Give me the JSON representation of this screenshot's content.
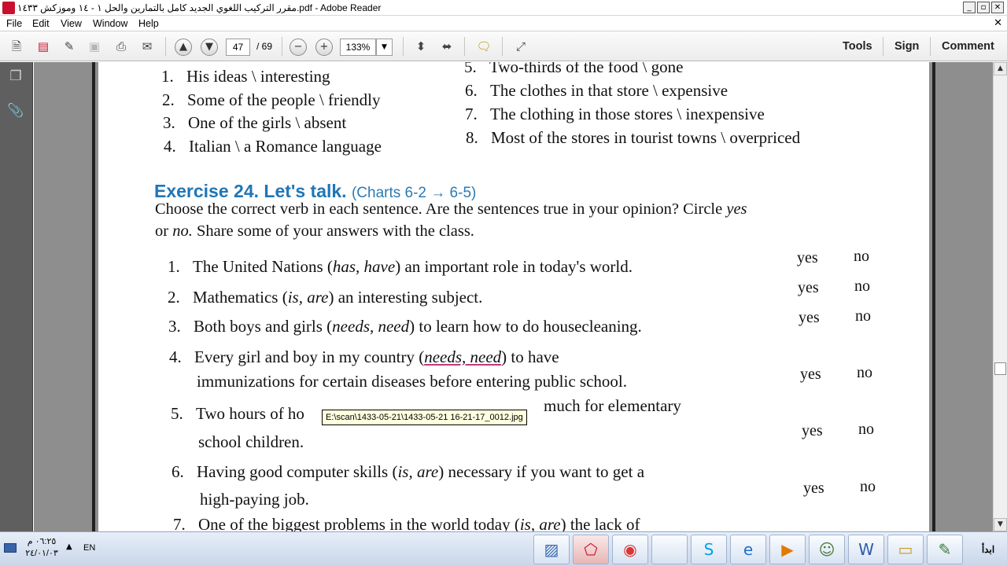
{
  "window": {
    "title": "مقرر التركيب اللغوي  الجديد كامل  بالتمارين والحل ١ - ١٤  وموزكش ١٤٣٣.pdf - Adobe Reader",
    "min_label": "_",
    "max_label": "▫",
    "close_label": "✕"
  },
  "menu": {
    "items": [
      "File",
      "Edit",
      "View",
      "Window",
      "Help"
    ],
    "close_label": "✕"
  },
  "toolbar": {
    "current_page": "47",
    "total_pages": "/ 69",
    "zoom": "133%",
    "tools_label": "Tools",
    "sign_label": "Sign",
    "comment_label": "Comment",
    "icons": [
      "create-icon",
      "share-icon",
      "edit-icon",
      "save-icon",
      "print-icon",
      "email-icon",
      "page-up-icon",
      "page-down-icon",
      "zoom-out-icon",
      "zoom-in-icon",
      "fit-page-icon",
      "fit-width-icon",
      "comment-bubble-icon",
      "full-screen-icon"
    ]
  },
  "document": {
    "top_list_left": [
      {
        "n": "1.",
        "text": "His ideas \\ interesting"
      },
      {
        "n": "2.",
        "text": "Some of the people \\ friendly"
      },
      {
        "n": "3.",
        "text": "One of the girls \\ absent"
      },
      {
        "n": "4.",
        "text": "Italian \\ a Romance language"
      }
    ],
    "top_list_right": [
      {
        "n": "5.",
        "text": "Two-thirds of the food \\ gone"
      },
      {
        "n": "6.",
        "text": "The clothes in that store \\ expensive"
      },
      {
        "n": "7.",
        "text": "The clothing in those stores \\ inexpensive"
      },
      {
        "n": "8.",
        "text": "Most of the stores in tourist towns \\ overpriced"
      }
    ],
    "exercise_title": "Exercise 24. Let's talk.",
    "exercise_ref": "(Charts 6-2 → 6-5)",
    "instruction_1": "Choose the correct verb in each sentence.  Are the sentences true in your opinion?  Circle ",
    "instruction_yes": "yes",
    "instruction_2": "or ",
    "instruction_no": "no.",
    "instruction_3": "  Share some of your answers with the class.",
    "items": [
      {
        "n": "1.",
        "pre": "The United Nations (",
        "choice": "has, have",
        "post": ") an important role in today's world.",
        "line2": ""
      },
      {
        "n": "2.",
        "pre": "Mathematics (",
        "choice": "is, are",
        "post": ") an interesting subject.",
        "line2": ""
      },
      {
        "n": "3.",
        "pre": "Both boys and girls (",
        "choice": "needs, need",
        "post": ") to learn how to do housecleaning.",
        "line2": ""
      },
      {
        "n": "4.",
        "pre": "Every girl and boy in my country (",
        "choice": "needs, need",
        "post": ") to have",
        "line2": "immunizations for certain diseases before entering public school."
      },
      {
        "n": "5.",
        "pre": "Two hours of ho",
        "choice": "",
        "post": "",
        "line2": "school children.",
        "tail": "much for elementary"
      },
      {
        "n": "6.",
        "pre": "Having good computer skills (",
        "choice": "is, are",
        "post": ") necessary if you want to get a",
        "line2": "high-paying job."
      },
      {
        "n": "7.",
        "pre": "One of the biggest problems in the world today (",
        "choice": "is, are",
        "post": ") the lack of",
        "line2": ""
      }
    ],
    "yes_label": "yes",
    "no_label": "no"
  },
  "tooltip": "E:\\scan\\1433-05-21\\1433-05-21 16-21-17_0012.jpg",
  "taskbar": {
    "time": "٠٦:٢٥ م",
    "date": "٢٤/٠١/٠٣",
    "lang": "EN",
    "start_label": "ابدأ",
    "apps": [
      "photo-viewer-icon",
      "adobe-reader-icon",
      "chrome-icon",
      "blank-app-icon",
      "skype-icon",
      "internet-explorer-icon",
      "media-player-icon",
      "users-icon",
      "word-icon",
      "folder-icon",
      "pen-icon"
    ]
  },
  "colors": {
    "exercise_blue": "#1f76b6",
    "doc_background": "#8e8e8e",
    "nav_panel": "#5f5f5f",
    "tooltip_bg": "#ffffe1"
  }
}
